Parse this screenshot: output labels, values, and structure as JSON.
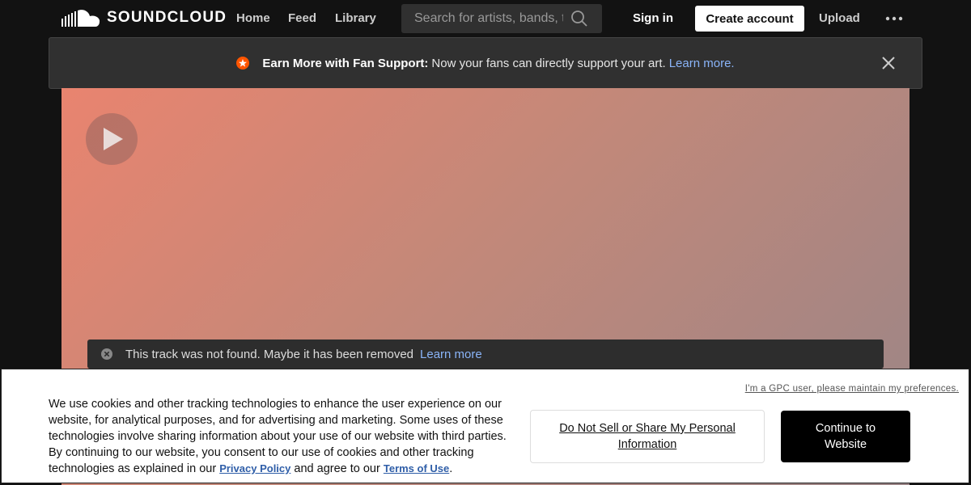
{
  "header": {
    "logo_text": "SOUNDCLOUD",
    "nav": [
      "Home",
      "Feed",
      "Library"
    ],
    "search_placeholder": "Search for artists, bands, tracks, podcasts",
    "sign_in": "Sign in",
    "create_account": "Create account",
    "upload": "Upload",
    "more_icon": "more-horizontal-icon"
  },
  "banner": {
    "strong": "Earn More with Fan Support:",
    "text": "Now your fans can directly support your art.",
    "link": "Learn more."
  },
  "player": {
    "notice_text": "This track was not found. Maybe it has been removed",
    "notice_link": "Learn more"
  },
  "cookie": {
    "gpc": "I'm a GPC user, please maintain my preferences.",
    "text_before": "We use cookies and other tracking technologies to enhance the user experience on our website, for analytical purposes, and for advertising and marketing. Some uses of these technologies involve sharing information about your use of our website with third parties. By continuing to our website, you consent to our use of cookies and other tracking technologies as explained in our ",
    "privacy_link": "Privacy Policy",
    "text_middle": " and agree to our ",
    "terms_link": "Terms of Use",
    "text_after": ".",
    "do_not_sell": "Do Not Sell or Share My Personal Information",
    "continue": "Continue to Website"
  },
  "colors": {
    "accent": "#ff5500",
    "link": "#8ab4f8",
    "hero_start": "#e9846f",
    "hero_end": "#9a8587"
  }
}
